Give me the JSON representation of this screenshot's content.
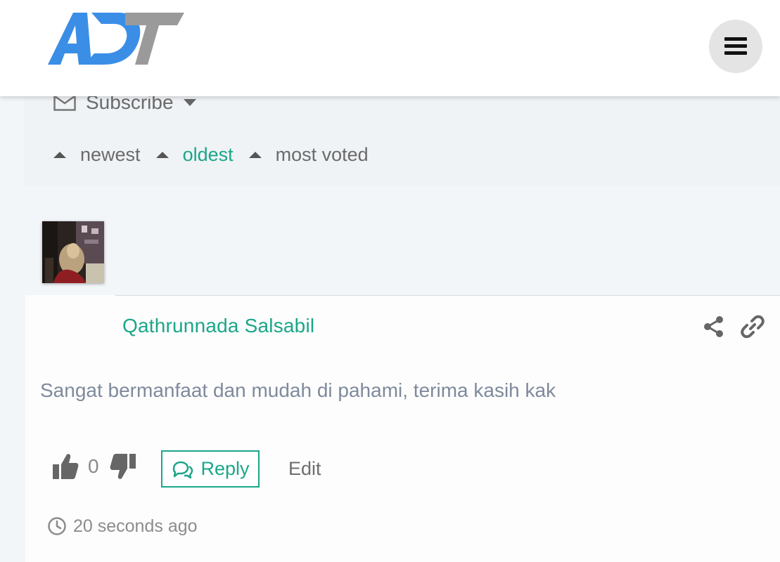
{
  "header": {
    "logo_alt": "ADT",
    "menu_icon": "hamburger-menu-icon"
  },
  "comments_toolbar": {
    "subscribe_label": "Subscribe",
    "sort_options": [
      {
        "label": "newest",
        "active": false
      },
      {
        "label": "oldest",
        "active": true
      },
      {
        "label": "most voted",
        "active": false
      }
    ]
  },
  "comment": {
    "author": "Qathrunnada Salsabil",
    "text": "Sangat bermanfaat dan mudah di pahami, terima kasih kak",
    "votes": "0",
    "reply_label": "Reply",
    "edit_label": "Edit",
    "timestamp": "20 seconds ago"
  },
  "colors": {
    "accent": "#1ba689",
    "logo_blue": "#3a8ee6",
    "logo_gray": "#9a9a9a",
    "page_bg": "#f2f6f9"
  }
}
